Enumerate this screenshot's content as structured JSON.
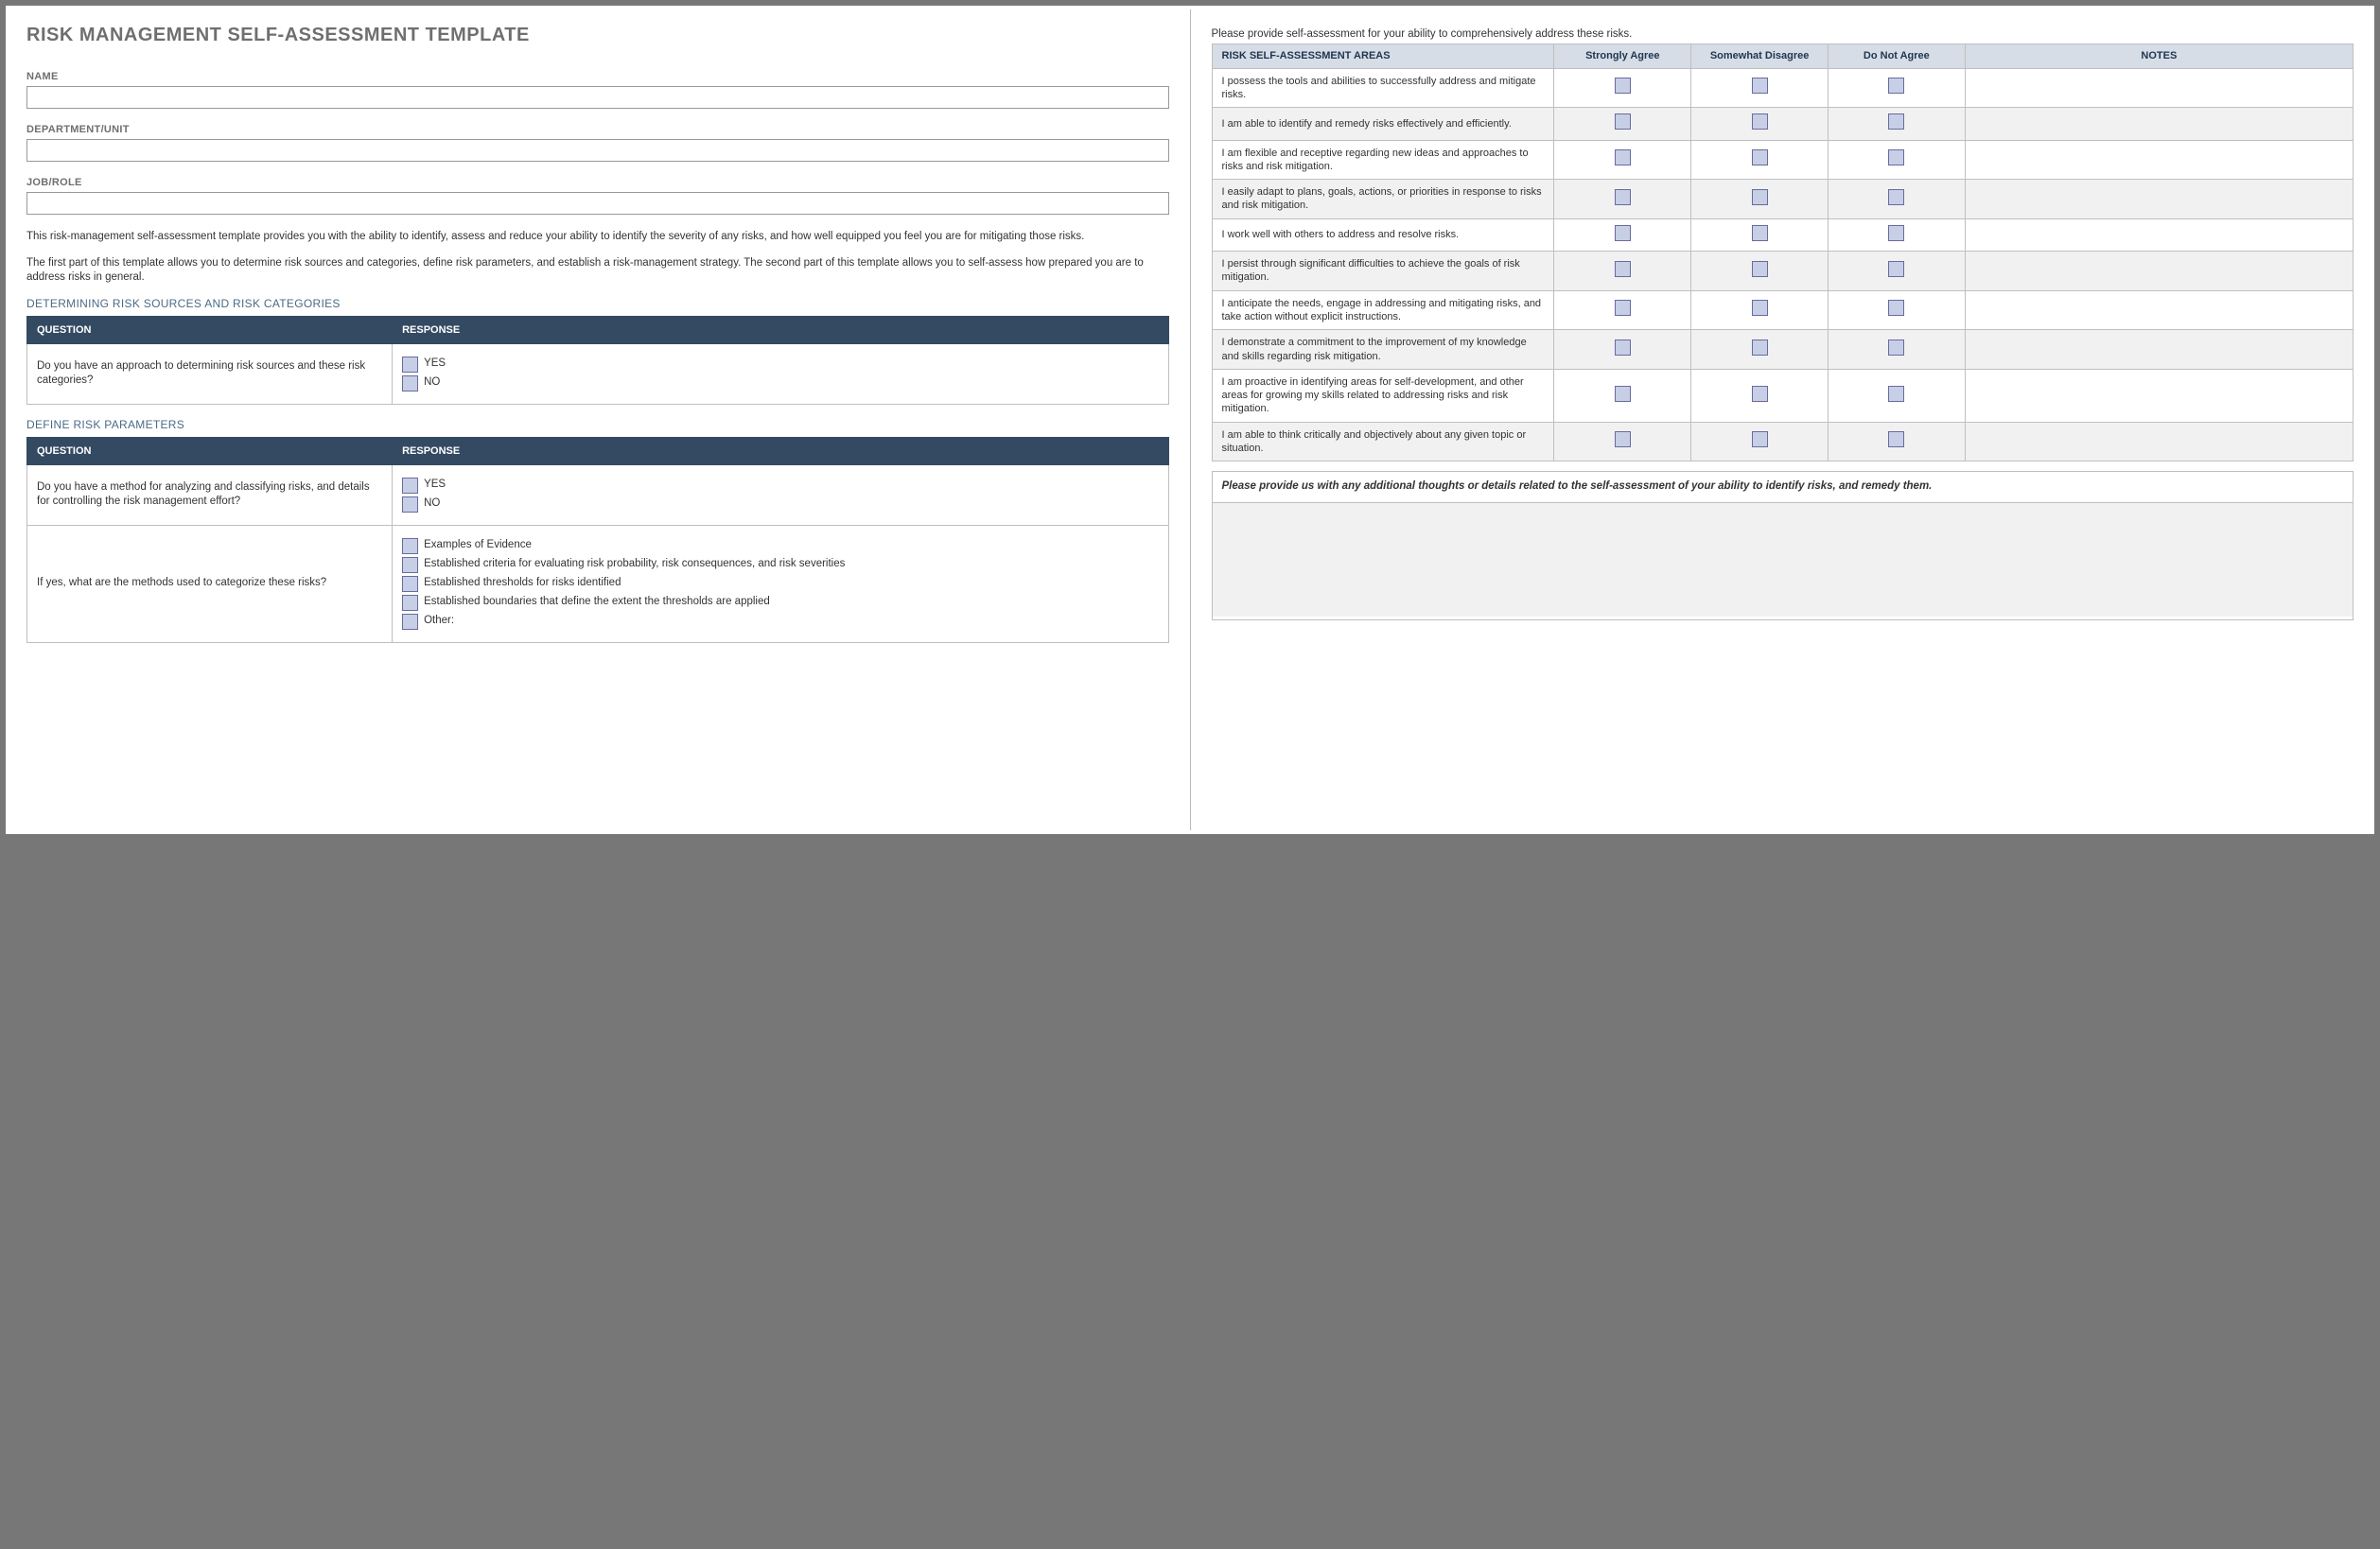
{
  "title": "RISK MANAGEMENT SELF-ASSESSMENT TEMPLATE",
  "fields": {
    "name_label": "NAME",
    "name_value": "",
    "dept_label": "DEPARTMENT/UNIT",
    "dept_value": "",
    "job_label": "JOB/ROLE",
    "job_value": ""
  },
  "intro": {
    "p1": "This risk-management self-assessment template provides you with the ability to identify, assess and reduce your ability to identify the severity of any risks, and how well equipped you feel you are for mitigating those risks.",
    "p2": "The first part of this template allows you to determine risk sources and categories, define risk parameters, and establish a risk-management strategy. The second part of this template allows you to self-assess how prepared you are to address risks in general."
  },
  "table_headers": {
    "question": "QUESTION",
    "response": "RESPONSE"
  },
  "sec1": {
    "heading": "DETERMINING RISK SOURCES AND RISK CATEGORIES",
    "q1": "Do you have an approach to determining risk sources and these risk categories?",
    "yes": "YES",
    "no": "NO"
  },
  "sec2": {
    "heading": "DEFINE RISK PARAMETERS",
    "q1": "Do you have a method for analyzing and classifying risks, and details for controlling the risk management effort?",
    "yes": "YES",
    "no": "NO",
    "q2": "If yes, what are the methods used to categorize these risks?",
    "opts": {
      "a": "Examples of Evidence",
      "b": "Established criteria for evaluating risk probability, risk consequences, and risk severities",
      "c": "Established thresholds for risks identified",
      "d": "Established boundaries that define the extent the thresholds are applied",
      "e": "Other:"
    }
  },
  "assess_instruct": "Please provide self-assessment for your ability to comprehensively address these risks.",
  "assess_headers": {
    "area": "RISK SELF-ASSESSMENT AREAS",
    "sa": "Strongly Agree",
    "sd": "Somewhat Disagree",
    "dna": "Do Not Agree",
    "notes": "NOTES"
  },
  "assess_rows": [
    "I possess the tools and abilities to successfully address and mitigate risks.",
    "I am able to identify and remedy risks effectively and efficiently.",
    "I am flexible and receptive regarding new ideas and approaches to risks and risk mitigation.",
    "I easily adapt to plans, goals, actions, or priorities in response to risks and risk mitigation.",
    "I work well with others to address and resolve risks.",
    "I persist through significant difficulties to achieve the goals of risk mitigation.",
    "I anticipate the needs, engage in addressing and mitigating risks, and take action without explicit instructions.",
    "I demonstrate a commitment to the improvement of my knowledge and skills regarding risk mitigation.",
    "I am proactive in identifying areas for self-development, and other areas for growing my skills related to addressing risks and risk mitigation.",
    "I am able to think critically and objectively about any given topic or situation."
  ],
  "additional": {
    "prompt": "Please provide us with any additional thoughts or details related to the self-assessment of your ability to identify risks, and remedy them.",
    "value": ""
  }
}
